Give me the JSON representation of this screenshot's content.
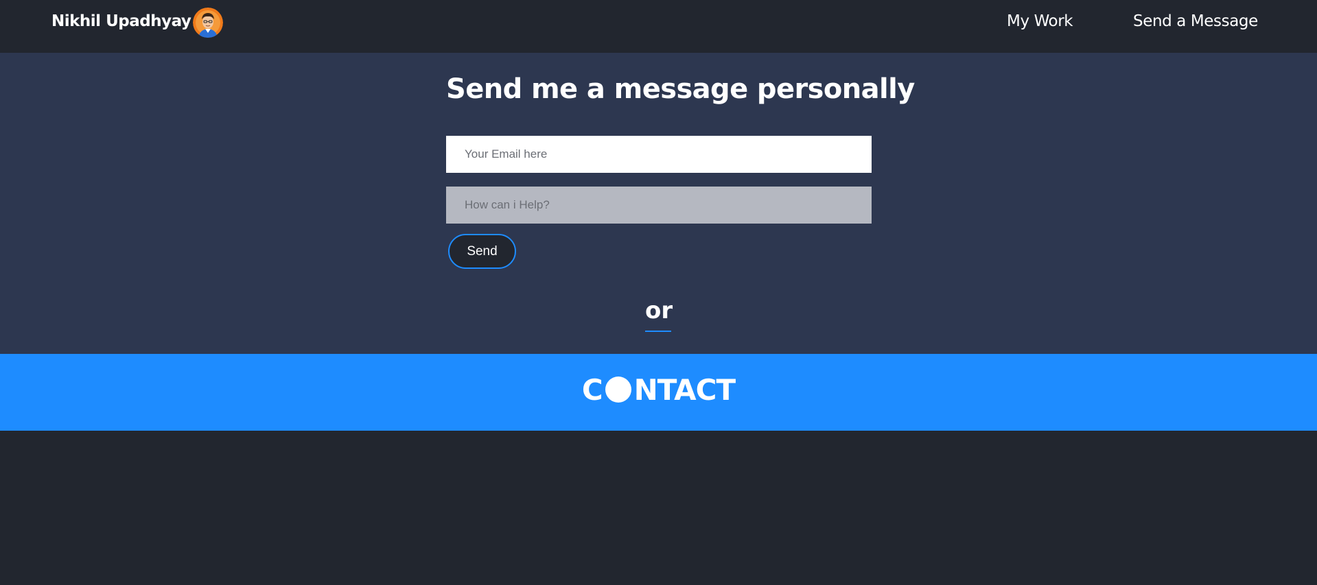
{
  "navbar": {
    "brand": "Nikhil Upadhyay",
    "avatar_icon": "avatar-icon",
    "links": [
      {
        "label": "My Work"
      },
      {
        "label": "Send a Message"
      }
    ]
  },
  "message_section": {
    "title": "Send me a message personally",
    "email_placeholder": "Your Email here",
    "email_value": "",
    "help_placeholder": "How can i Help?",
    "help_value": "",
    "send_label": "Send",
    "or_label": "or"
  },
  "contact": {
    "title_prefix": "C",
    "title_suffix": "NTACT"
  },
  "colors": {
    "nav_bg": "#22262f",
    "section_bg": "#2d3750",
    "accent": "#1e8cff",
    "help_field_bg": "#b5b8c1"
  }
}
